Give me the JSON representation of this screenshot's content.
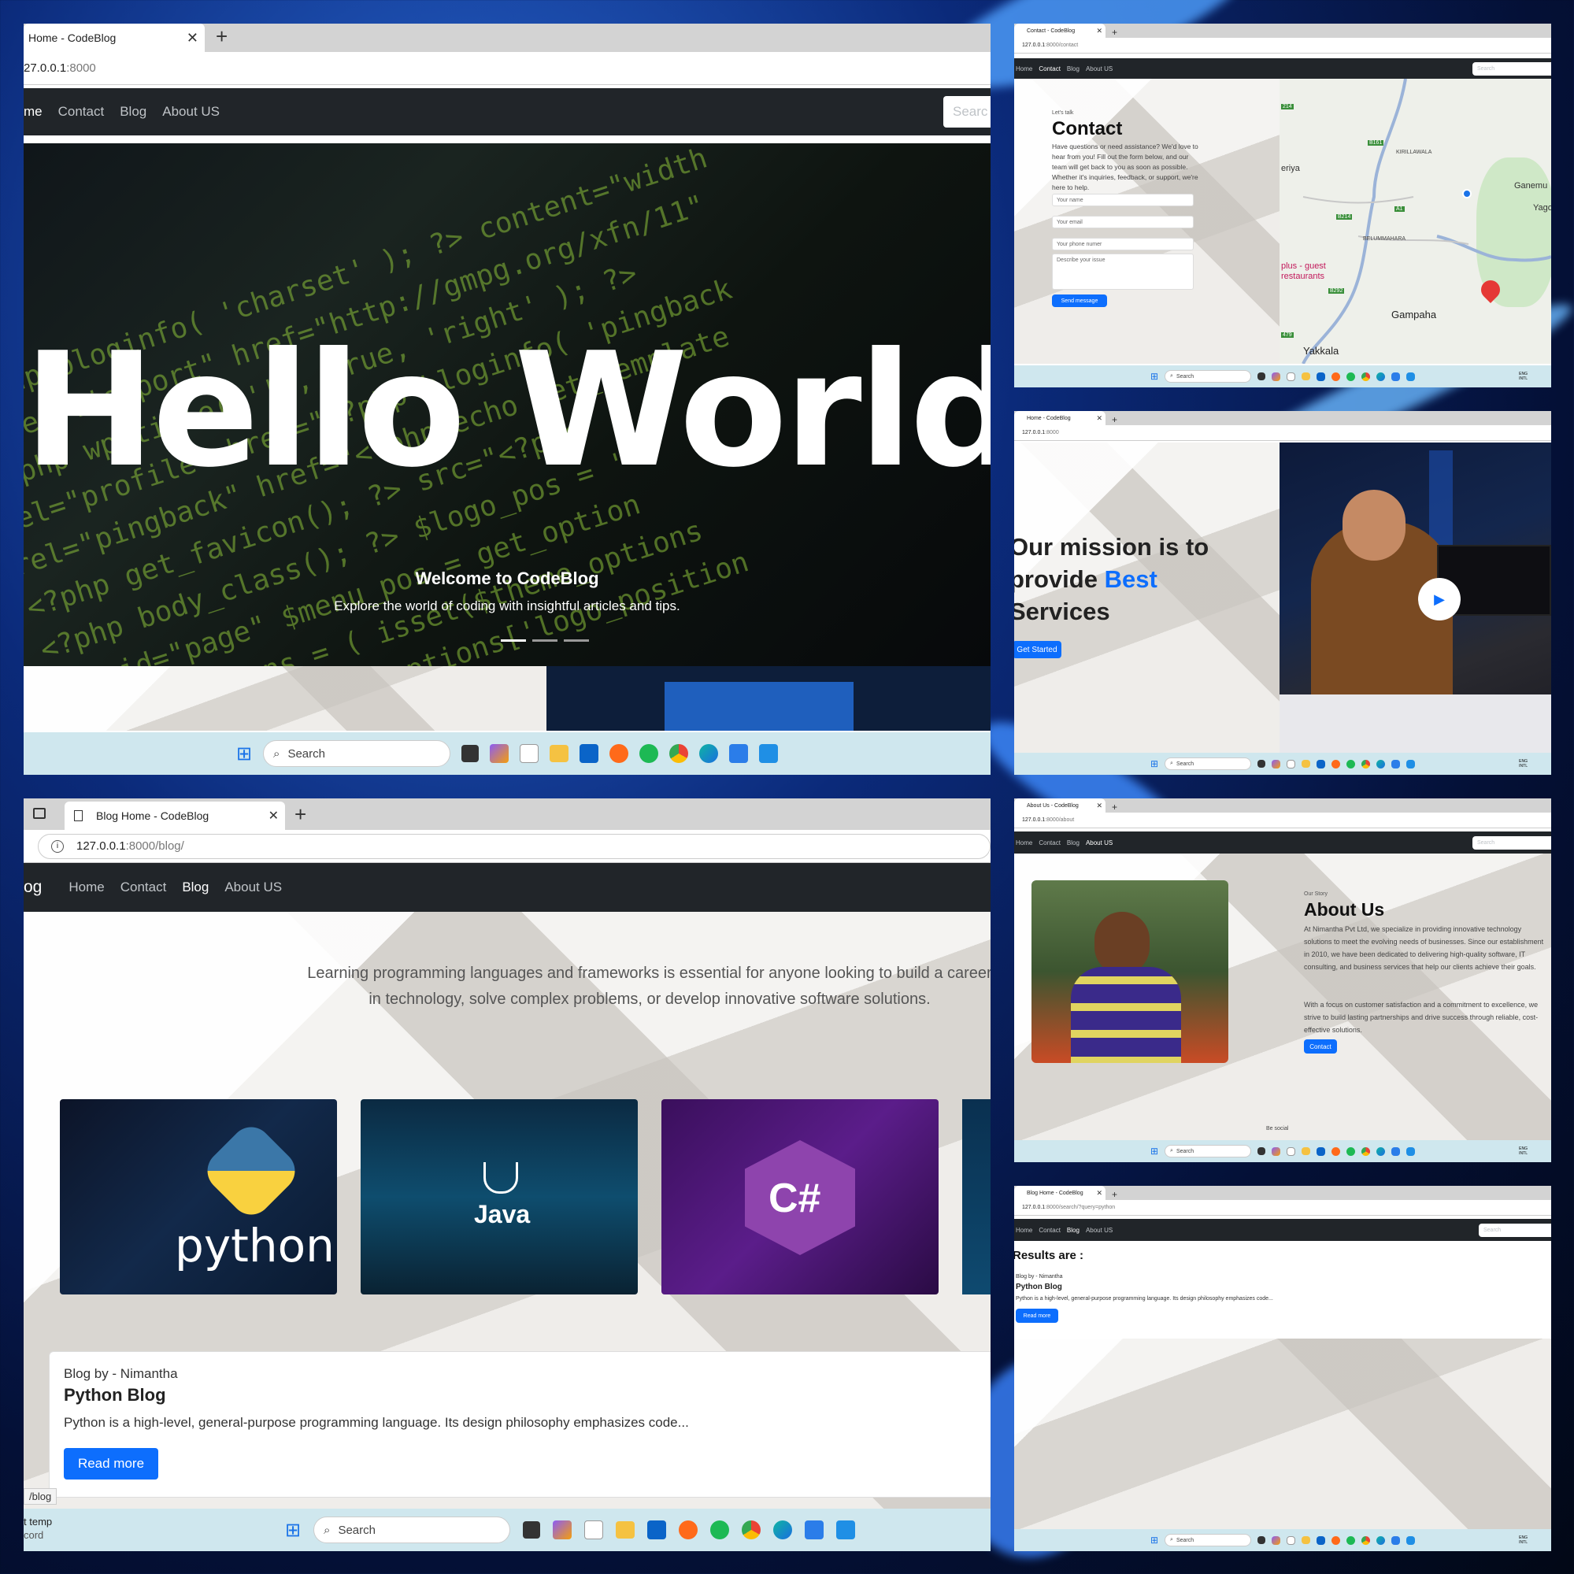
{
  "taskbar": {
    "search": "Search",
    "lang": "ENG\nINTL"
  },
  "home": {
    "tab_title": "Home - CodeBlog",
    "url_host": "27.0.0.1",
    "url_port": ":8000",
    "nav": [
      "me",
      "Contact",
      "Blog",
      "About US"
    ],
    "search": "Searc",
    "hero_text": "Hello World",
    "caption_title": "Welcome to CodeBlog",
    "caption_text": "Explore the world of coding with insightful articles and tips."
  },
  "contact": {
    "tab_title": "Contact - CodeBlog",
    "url_host": "127.0.0.1",
    "url_path": ":8000/contact",
    "nav": [
      "Home",
      "Contact",
      "Blog",
      "About US"
    ],
    "search": "Search",
    "eyebrow": "Let's talk",
    "heading": "Contact",
    "intro": "Have questions or need assistance? We'd love to hear from you! Fill out the form below, and our team will get back to you as soon as possible. Whether it's inquiries, feedback, or support, we're here to help.",
    "name_ph": "Your name",
    "email_ph": "Your email",
    "phone_ph": "Your phone numer",
    "issue_ph": "Describe your issue",
    "send": "Send message",
    "map": {
      "town": "Gampaha",
      "yakkala": "Yakkala",
      "belummahara": "BELUMMAHARA",
      "kiriliawala": "KIRILLAWALA",
      "eriya": "eriya",
      "ganemu": "Ganemu",
      "yago": "Yago",
      "restaurants": "plus - guest\nrestaurants",
      "b161": "B161",
      "b214": "B214",
      "a1": "A1",
      "b292": "B292",
      "r214": "214",
      "r479": "479"
    }
  },
  "mission": {
    "tab_title": "Home - CodeBlog",
    "url_host": "127.0.0.1",
    "url_path": ":8000",
    "line1": "Our mission is to",
    "line2a": "provide ",
    "line2b": "Best",
    "line3": "Services",
    "cta": "Get Started"
  },
  "blog": {
    "tab_title": "Blog Home - CodeBlog",
    "url_host": "127.0.0.1",
    "url_path": ":8000/blog/",
    "brand": "og",
    "nav": [
      "Home",
      "Contact",
      "Blog",
      "About US"
    ],
    "intro": "Learning programming languages and frameworks is essential for anyone looking to build a career in technology, solve complex problems, or develop innovative software solutions.",
    "card_python": "python",
    "card_java": "Java",
    "card_csharp": "C#",
    "post_by": "Blog by - Nimantha",
    "post_title": "Python Blog",
    "post_excerpt": "Python is a high-level, general-purpose programming language. Its design philosophy emphasizes code...",
    "read_more": "Read more",
    "status_url": "/blog",
    "weather1": "t temp",
    "weather2": "cord"
  },
  "about": {
    "tab_title": "About Us - CodeBlog",
    "url_host": "127.0.0.1",
    "url_path": ":8000/about",
    "nav": [
      "Home",
      "Contact",
      "Blog",
      "About US"
    ],
    "search": "Search",
    "eyebrow": "Our Story",
    "heading": "About Us",
    "p1": "At Nimantha Pvt Ltd, we specialize in providing innovative technology solutions to meet the evolving needs of businesses. Since our establishment in 2010, we have been dedicated to delivering high-quality software, IT consulting, and business services that help our clients achieve their goals.",
    "p2": "With a focus on customer satisfaction and a commitment to excellence, we strive to build lasting partnerships and drive success through reliable, cost-effective solutions.",
    "contact_btn": "Contact",
    "social": "Be social"
  },
  "search_page": {
    "tab_title": "Blog Home - CodeBlog",
    "url_host": "127.0.0.1",
    "url_path": ":8000/search/?query=python",
    "nav": [
      "Home",
      "Contact",
      "Blog",
      "About US"
    ],
    "search": "Search",
    "results": "Results are :",
    "post_by": "Blog by - Nimantha",
    "post_title": "Python Blog",
    "post_excerpt": "Python is a high-level, general-purpose programming language. Its design philosophy emphasizes code...",
    "read_more": "Read more"
  }
}
